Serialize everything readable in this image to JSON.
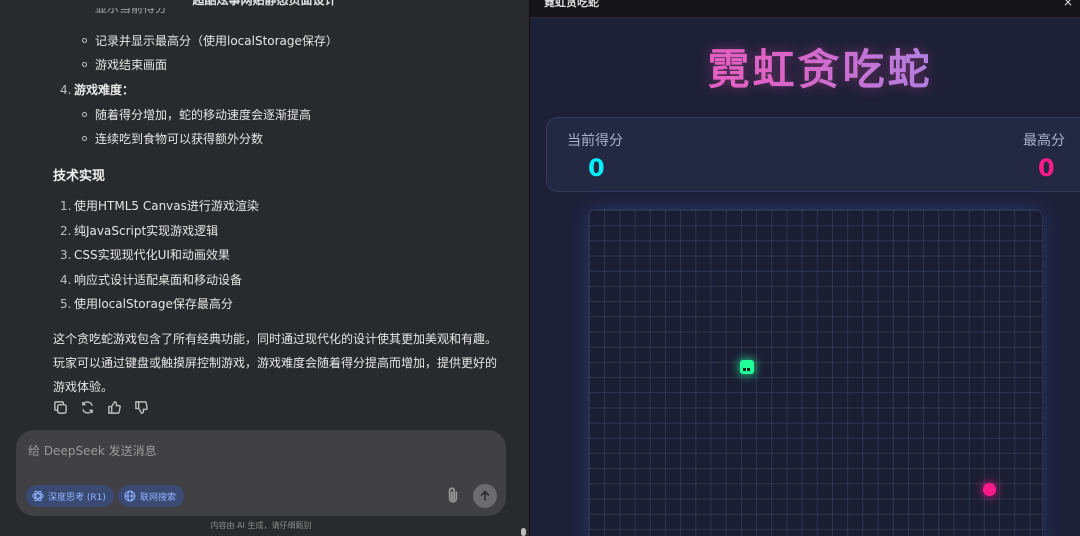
{
  "left": {
    "top_title": "超酷炫事网贴静态页面设计",
    "cutoff_text": "显示当前得分",
    "list_a": [
      "记录并显示最高分（使用localStorage保存）",
      "游戏结束画面"
    ],
    "item4": {
      "num": "4.",
      "label": "游戏难度："
    },
    "list_b": [
      "随着得分增加，蛇的移动速度会逐渐提高",
      "连续吃到食物可以获得额外分数"
    ],
    "section_title": "技术实现",
    "tech_items": [
      {
        "num": "1.",
        "text": "使用HTML5 Canvas进行游戏渲染"
      },
      {
        "num": "2.",
        "text": "纯JavaScript实现游戏逻辑"
      },
      {
        "num": "3.",
        "text": "CSS实现现代化UI和动画效果"
      },
      {
        "num": "4.",
        "text": "响应式设计适配桌面和移动设备"
      },
      {
        "num": "5.",
        "text": "使用localStorage保存最高分"
      }
    ],
    "paragraph": "这个贪吃蛇游戏包含了所有经典功能，同时通过现代化的设计使其更加美观和有趣。玩家可以通过键盘或触摸屏控制游戏，游戏难度会随着得分提高而增加，提供更好的游戏体验。",
    "input_placeholder": "给 DeepSeek 发送消息",
    "chip_deepthink": "深度思考 (R1)",
    "chip_search": "联网搜索",
    "footer": "内容由 AI 生成，请仔细甄别"
  },
  "right": {
    "window_title": "霓虹贪吃蛇",
    "close": "×",
    "game_title": "霓虹贪吃蛇",
    "current_label": "当前得分",
    "current_value": "0",
    "high_label": "最高分",
    "high_value": "0"
  },
  "colors": {
    "current_score": "#00f0ff",
    "high_score": "#ff1a8c",
    "snake": "#22ff99",
    "food": "#ff1a8c"
  }
}
